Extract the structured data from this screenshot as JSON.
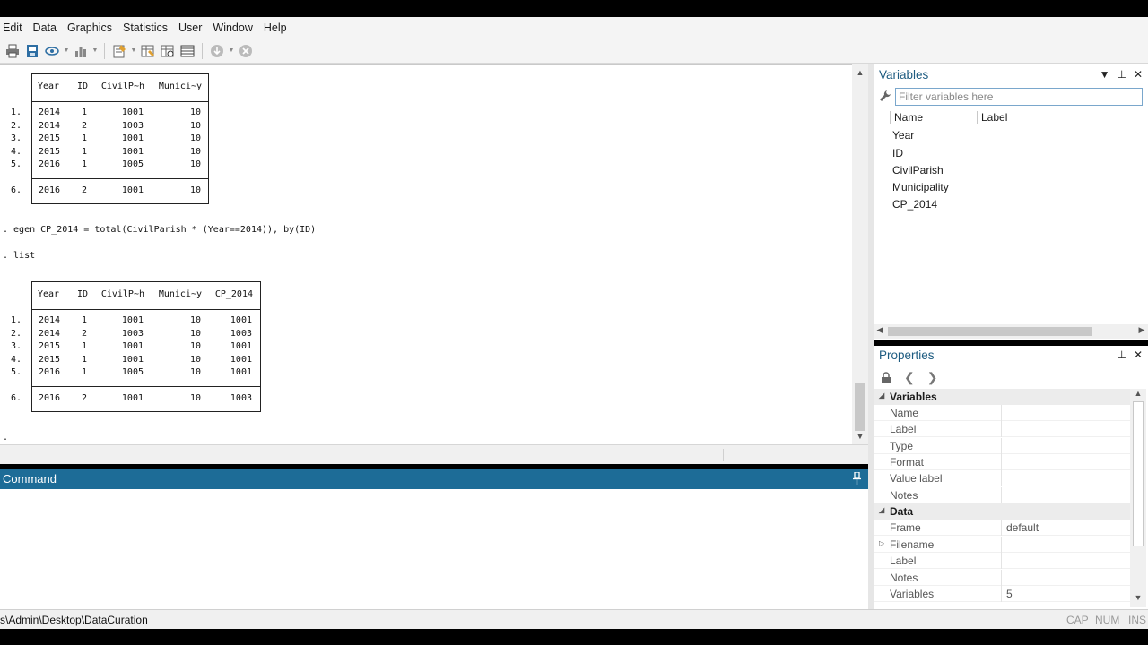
{
  "menu": [
    "Edit",
    "Data",
    "Graphics",
    "Statistics",
    "User",
    "Window",
    "Help"
  ],
  "toolbar_icons": [
    "print-icon",
    "log-icon",
    "viewer-icon",
    "graph-icon",
    "do-file-editor-icon",
    "data-editor-icon",
    "data-browser-icon",
    "variables-manager-icon",
    "more-icon",
    "break-icon"
  ],
  "results": {
    "table1": {
      "headers": [
        "Year",
        "ID",
        "CivilP~h",
        "Munici~y"
      ],
      "rows": [
        {
          "n": "1.",
          "cells": [
            "2014",
            "1",
            "1001",
            "10"
          ]
        },
        {
          "n": "2.",
          "cells": [
            "2014",
            "2",
            "1003",
            "10"
          ]
        },
        {
          "n": "3.",
          "cells": [
            "2015",
            "1",
            "1001",
            "10"
          ]
        },
        {
          "n": "4.",
          "cells": [
            "2015",
            "1",
            "1001",
            "10"
          ]
        },
        {
          "n": "5.",
          "cells": [
            "2016",
            "1",
            "1005",
            "10"
          ]
        },
        {
          "n": "6.",
          "cells": [
            "2016",
            "2",
            "1001",
            "10"
          ]
        }
      ]
    },
    "cmd1": ". egen CP_2014 = total(CivilParish * (Year==2014)), by(ID)",
    "cmd2": ". list",
    "table2": {
      "headers": [
        "Year",
        "ID",
        "CivilP~h",
        "Munici~y",
        "CP_2014"
      ],
      "rows": [
        {
          "n": "1.",
          "cells": [
            "2014",
            "1",
            "1001",
            "10",
            "1001"
          ]
        },
        {
          "n": "2.",
          "cells": [
            "2014",
            "2",
            "1003",
            "10",
            "1003"
          ]
        },
        {
          "n": "3.",
          "cells": [
            "2015",
            "1",
            "1001",
            "10",
            "1001"
          ]
        },
        {
          "n": "4.",
          "cells": [
            "2015",
            "1",
            "1001",
            "10",
            "1001"
          ]
        },
        {
          "n": "5.",
          "cells": [
            "2016",
            "1",
            "1005",
            "10",
            "1001"
          ]
        },
        {
          "n": "6.",
          "cells": [
            "2016",
            "2",
            "1001",
            "10",
            "1003"
          ]
        }
      ]
    },
    "prompt": "."
  },
  "command": {
    "title": "Command"
  },
  "variables": {
    "title": "Variables",
    "filter_placeholder": "Filter variables here",
    "col_name": "Name",
    "col_label": "Label",
    "items": [
      "Year",
      "ID",
      "CivilParish",
      "Municipality",
      "CP_2014"
    ]
  },
  "properties": {
    "title": "Properties",
    "sections": [
      {
        "label": "Variables",
        "rows": [
          {
            "k": "Name",
            "v": ""
          },
          {
            "k": "Label",
            "v": ""
          },
          {
            "k": "Type",
            "v": ""
          },
          {
            "k": "Format",
            "v": ""
          },
          {
            "k": "Value label",
            "v": ""
          },
          {
            "k": "Notes",
            "v": ""
          }
        ]
      },
      {
        "label": "Data",
        "rows": [
          {
            "k": "Frame",
            "v": "default"
          },
          {
            "k": "Filename",
            "v": ""
          },
          {
            "k": "Label",
            "v": ""
          },
          {
            "k": "Notes",
            "v": ""
          },
          {
            "k": "Variables",
            "v": "5"
          }
        ]
      }
    ]
  },
  "status": {
    "path": "s\\Admin\\Desktop\\DataCuration",
    "cap": "CAP",
    "num": "NUM",
    "ins": "INS"
  }
}
